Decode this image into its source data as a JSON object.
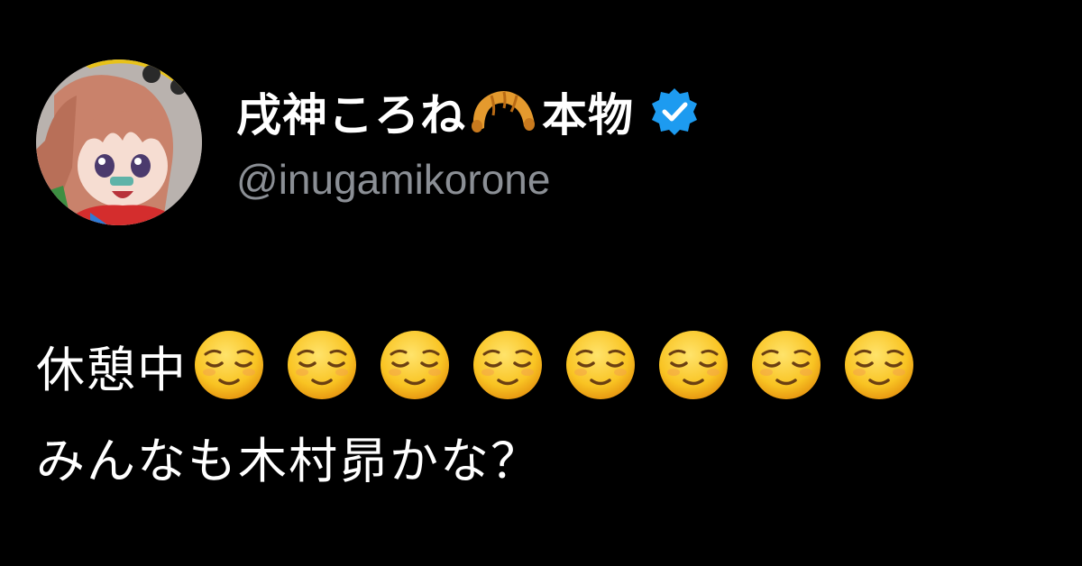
{
  "tweet": {
    "display_name_part1": "戌神ころね",
    "display_name_part2": "本物",
    "name_emoji": "croissant-icon",
    "verified_badge": "verified-icon",
    "handle": "@inugamikorone",
    "text_line1": "休憩中",
    "emoji_run": {
      "icon": "relieved-face-icon",
      "count": 8
    },
    "text_line2": "みんなも木村昴かな？"
  },
  "colors": {
    "background": "#000000",
    "name_text": "#ffffff",
    "handle_text": "#8b8f95",
    "verified_blue": "#1d9bf0"
  }
}
